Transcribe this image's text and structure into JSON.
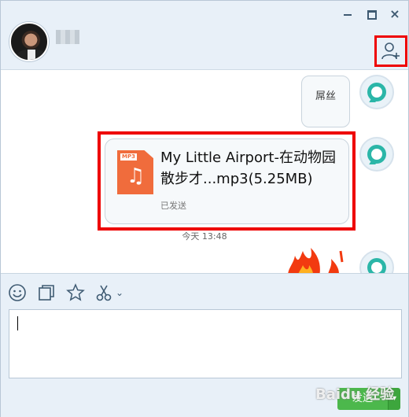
{
  "header": {
    "window_controls": {
      "minimize_icon": "minimize-icon",
      "maximize_icon": "maximize-icon",
      "close_icon": "close-icon",
      "close_glyph": "×"
    },
    "add_user_icon": "add-user-icon"
  },
  "messages": {
    "text_bubble": "屌丝",
    "file": {
      "ext_label": "MP3",
      "name": "My Little Airport-在动物园散步才...mp3(5.25MB)",
      "status": "已发送"
    },
    "timestamp": "今天 13:48"
  },
  "toolbar": {
    "icons": [
      "emoji-icon",
      "screenshot-window-icon",
      "favorite-star-icon",
      "scissors-icon"
    ],
    "dropdown_glyph": "⌄"
  },
  "input": {
    "value": ""
  },
  "send": {
    "label": "发送",
    "arrow": "▾"
  },
  "watermark": "Baidu 经验",
  "colors": {
    "accent_red": "#ee0000",
    "send_green": "#4cb84c",
    "qq_teal": "#2bb6a8",
    "file_orange": "#f06c3c"
  }
}
